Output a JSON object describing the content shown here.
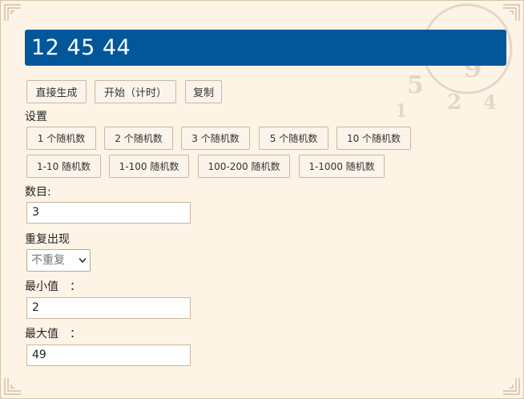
{
  "result": {
    "text": "12 45 44"
  },
  "actions": {
    "generate": "直接生成",
    "start": "开始（计时）",
    "copy": "复制"
  },
  "settings": {
    "title": "设置",
    "presets_row1": [
      "1 个随机数",
      "2 个随机数",
      "3 个随机数",
      "5 个随机数",
      "10 个随机数"
    ],
    "presets_row2": [
      "1-10 随机数",
      "1-100 随机数",
      "100-200 随机数",
      "1-1000 随机数"
    ]
  },
  "form": {
    "count_label": "数目:",
    "count_value": "3",
    "repeat_label": "重复出现",
    "repeat_value": "不重复",
    "min_label": "最小值　：",
    "min_value": "2",
    "max_label": "最大值　：",
    "max_value": "49"
  },
  "theme": {
    "result_bg": "#02579b",
    "page_bg": "#fdf4e6"
  }
}
